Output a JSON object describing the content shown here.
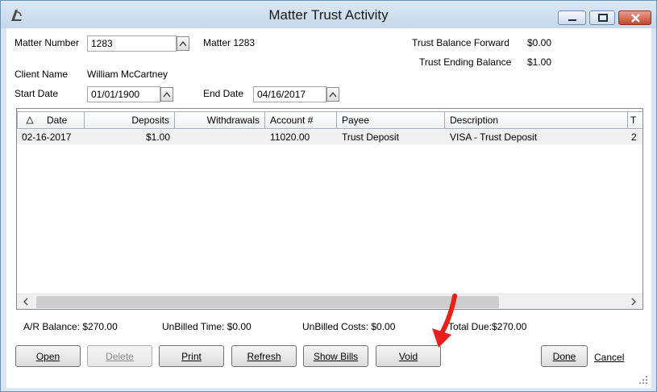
{
  "window": {
    "title": "Matter Trust Activity",
    "accent_color": "#c7452b",
    "icons": {
      "app": "app-logo-icon",
      "minimize": "minimize-icon",
      "maximize": "maximize-icon",
      "close": "close-icon"
    }
  },
  "form": {
    "matter_number_label": "Matter Number",
    "matter_number_value": "1283",
    "matter_display": "Matter 1283",
    "trust_balance_forward_label": "Trust Balance Forward",
    "trust_balance_forward_value": "$0.00",
    "trust_ending_balance_label": "Trust Ending Balance",
    "trust_ending_balance_value": "$1.00",
    "client_name_label": "Client Name",
    "client_name_value": "William McCartney",
    "start_date_label": "Start Date",
    "start_date_value": "01/01/1900",
    "end_date_label": "End Date",
    "end_date_value": "04/16/2017"
  },
  "grid": {
    "columns": [
      "Date",
      "Deposits",
      "Withdrawals",
      "Account #",
      "Payee",
      "Description",
      "T"
    ],
    "rows": [
      {
        "date": "02-16-2017",
        "deposits": "$1.00",
        "withdrawals": "",
        "account": "11020.00",
        "payee": "Trust Deposit",
        "description": "VISA - Trust Deposit",
        "t": "2"
      }
    ]
  },
  "summary": {
    "ar_balance": "A/R Balance: $270.00",
    "unbilled_time": "UnBilled Time: $0.00",
    "unbilled_costs": "UnBilled Costs: $0.00",
    "total_due": "Total Due:$270.00"
  },
  "buttons": {
    "open": "Open",
    "delete": "Delete",
    "print": "Print",
    "refresh": "Refresh",
    "show_bills": "Show Bills",
    "void": "Void",
    "done": "Done",
    "cancel": "Cancel"
  },
  "annotation": {
    "arrow_color": "#e8201c"
  }
}
